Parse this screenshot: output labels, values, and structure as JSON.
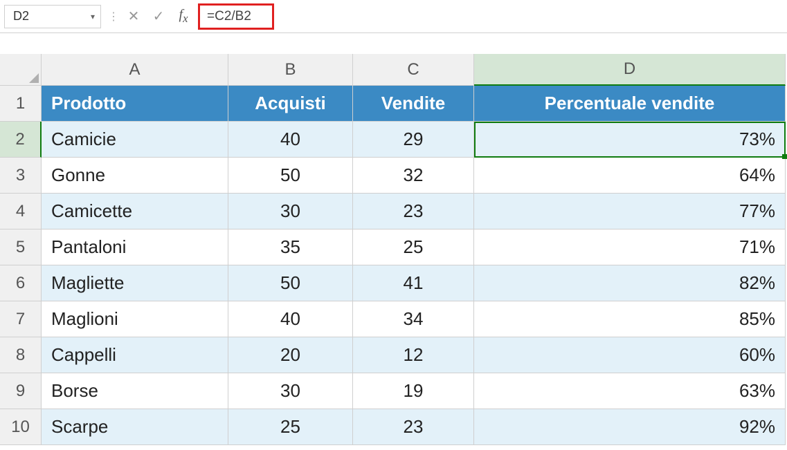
{
  "name_box": "D2",
  "formula": "=C2/B2",
  "columns": [
    "A",
    "B",
    "C",
    "D"
  ],
  "headers": {
    "A": "Prodotto",
    "B": "Acquisti",
    "C": "Vendite",
    "D": "Percentuale vendite"
  },
  "rows": [
    {
      "n": 2,
      "A": "Camicie",
      "B": "40",
      "C": "29",
      "D": "73%"
    },
    {
      "n": 3,
      "A": "Gonne",
      "B": "50",
      "C": "32",
      "D": "64%"
    },
    {
      "n": 4,
      "A": "Camicette",
      "B": "30",
      "C": "23",
      "D": "77%"
    },
    {
      "n": 5,
      "A": "Pantaloni",
      "B": "35",
      "C": "25",
      "D": "71%"
    },
    {
      "n": 6,
      "A": "Magliette",
      "B": "50",
      "C": "41",
      "D": "82%"
    },
    {
      "n": 7,
      "A": "Maglioni",
      "B": "40",
      "C": "34",
      "D": "85%"
    },
    {
      "n": 8,
      "A": "Cappelli",
      "B": "20",
      "C": "12",
      "D": "60%"
    },
    {
      "n": 9,
      "A": "Borse",
      "B": "30",
      "C": "19",
      "D": "63%"
    },
    {
      "n": 10,
      "A": "Scarpe",
      "B": "25",
      "C": "23",
      "D": "92%"
    }
  ],
  "selected_cell": "D2"
}
